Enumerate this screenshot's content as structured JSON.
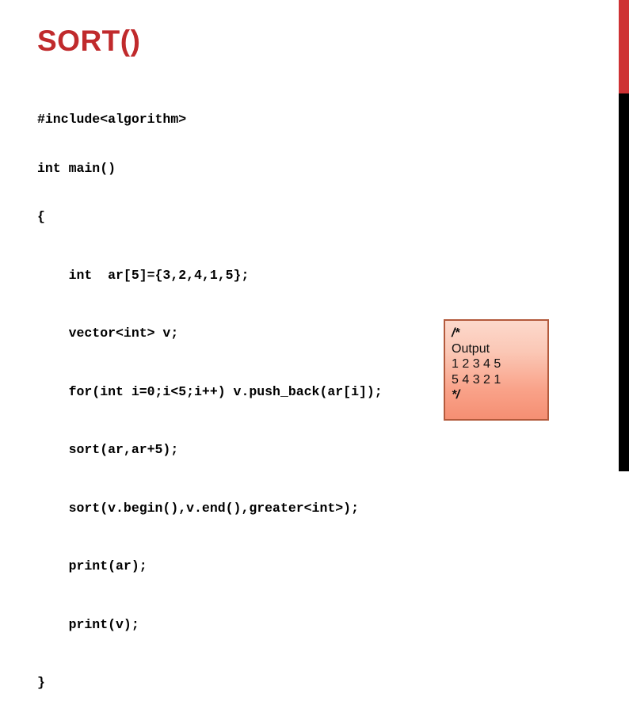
{
  "slide": {
    "title": "SORT()",
    "title_color": "#C02A2C",
    "background_color": "#FFFFFF"
  },
  "decor": {
    "red_bar_color": "#CE3234",
    "black_bar_color": "#000000"
  },
  "code": {
    "language": "cpp",
    "lines": [
      "#include<algorithm>",
      "int main()",
      "{",
      "    int  ar[5]={3,2,4,1,5};",
      "    vector<int> v;",
      "    for(int i=0;i<5;i++) v.push_back(ar[i]);",
      "    sort(ar,ar+5);",
      "    sort(v.begin(),v.end(),greater<int>);",
      "    print(ar);",
      "    print(v);",
      "}"
    ]
  },
  "output_box": {
    "border_color": "#B35A3C",
    "gradient_top": "#FCD9CC",
    "gradient_bottom": "#F58F73",
    "lines": [
      "/*",
      "Output",
      "1 2 3 4 5",
      "5 4 3 2 1",
      "*/"
    ]
  }
}
